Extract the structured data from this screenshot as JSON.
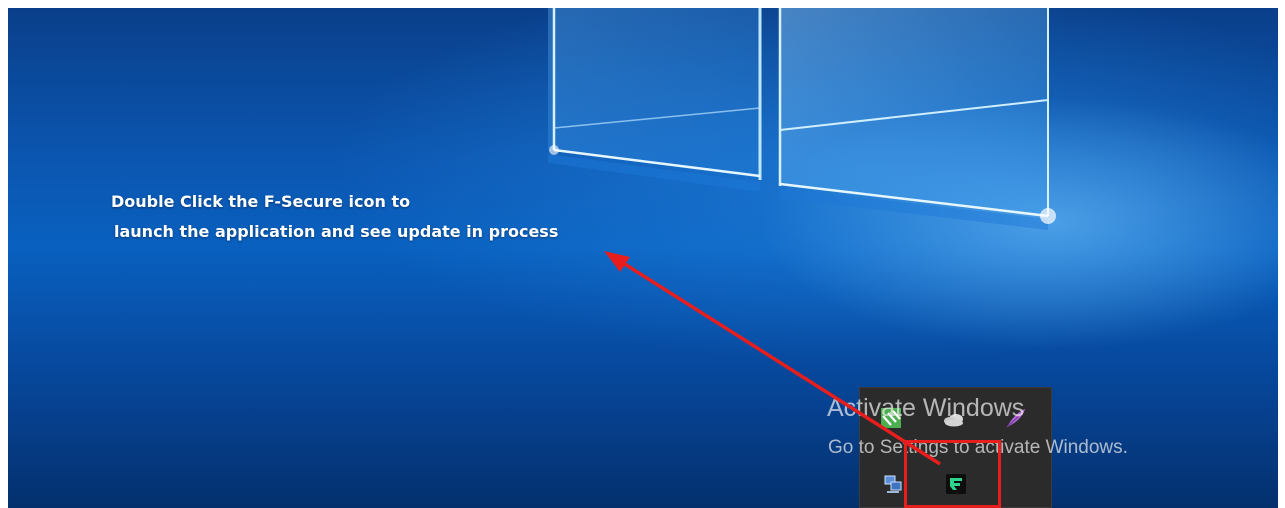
{
  "annotation": {
    "line1": "Double Click the F-Secure icon to",
    "line2": "launch the application and see update in process",
    "arrow_color": "#e81e1e"
  },
  "watermark": {
    "title": "Activate Windows",
    "subtitle": "Go to Settings to activate Windows."
  },
  "tray_flyout": {
    "icons": [
      {
        "name": "green-stripes-app-icon"
      },
      {
        "name": "onedrive-cloud-icon"
      },
      {
        "name": "purple-feather-icon"
      },
      {
        "name": "network-monitor-icon"
      },
      {
        "name": "f-secure-icon"
      }
    ]
  },
  "colors": {
    "desktop_blue": "#0960bf",
    "highlight_red": "#e81e1e",
    "f_secure_green": "#2bd68c",
    "flyout_background": "#2b2b2b"
  }
}
